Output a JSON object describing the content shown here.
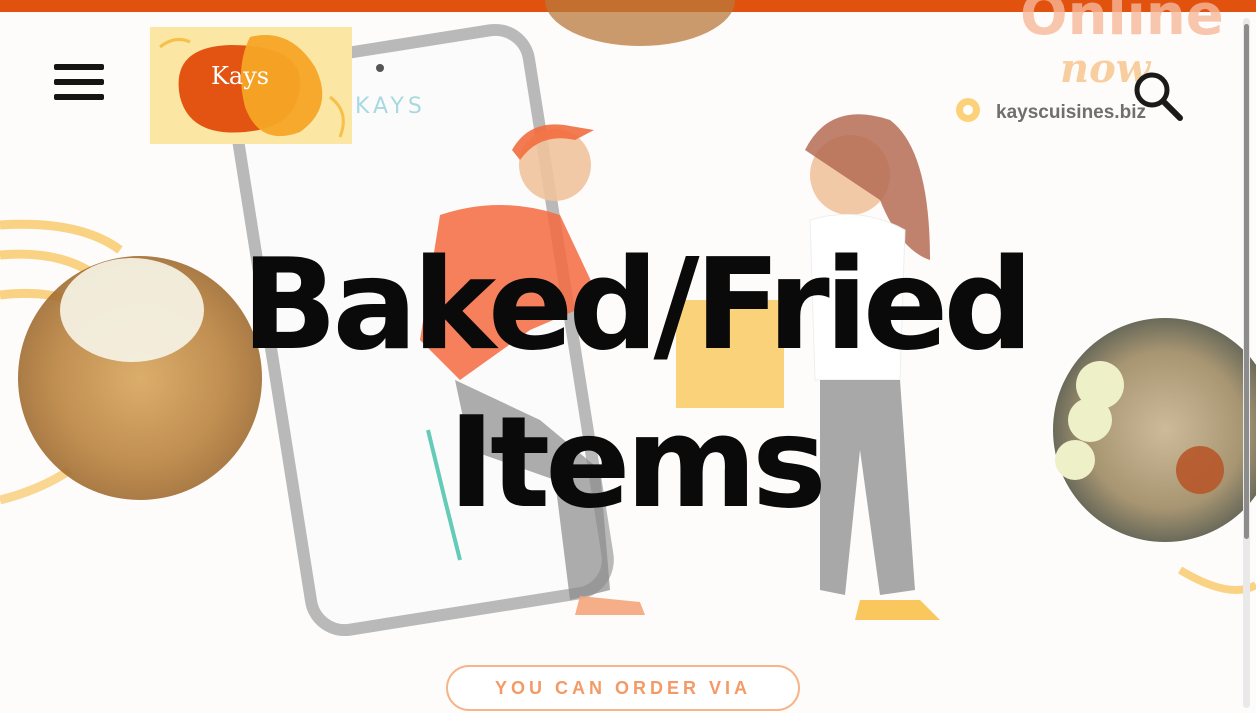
{
  "header": {
    "menu_icon": "hamburger-menu-icon",
    "search_icon": "search-icon",
    "logo_text": "Kays",
    "site_url": "kayscuisines.biz"
  },
  "hero": {
    "headline_line1": "Baked/Fried",
    "headline_line2": "Items",
    "phone_screen_text": "KAYS",
    "cta_label": "YOU CAN ORDER VIA"
  },
  "colors": {
    "brand_orange": "#e2520f",
    "logo_background": "#fbe7a3",
    "accent_yellow": "#f6c04a",
    "cta_text": "#f39a66"
  }
}
